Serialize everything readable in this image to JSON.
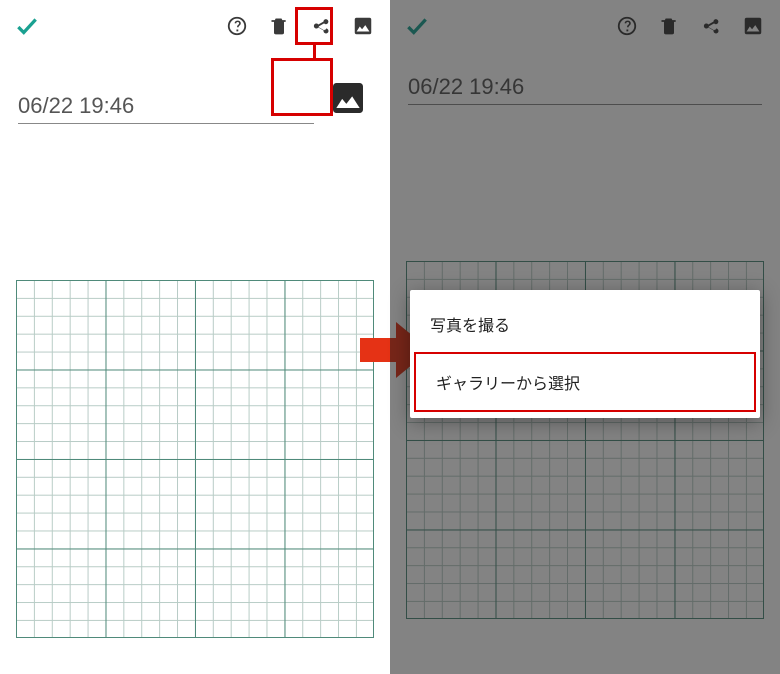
{
  "left": {
    "toolbar": {
      "check_label": "done",
      "help_label": "help",
      "delete_label": "delete",
      "share_label": "share",
      "image_label": "image"
    },
    "title": "06/22 19:46"
  },
  "right": {
    "toolbar": {
      "check_label": "done",
      "help_label": "help",
      "delete_label": "delete",
      "share_label": "share",
      "image_label": "image"
    },
    "title": "06/22 19:46",
    "menu": {
      "take_photo": "写真を撮る",
      "choose_gallery": "ギャラリーから選択"
    }
  }
}
